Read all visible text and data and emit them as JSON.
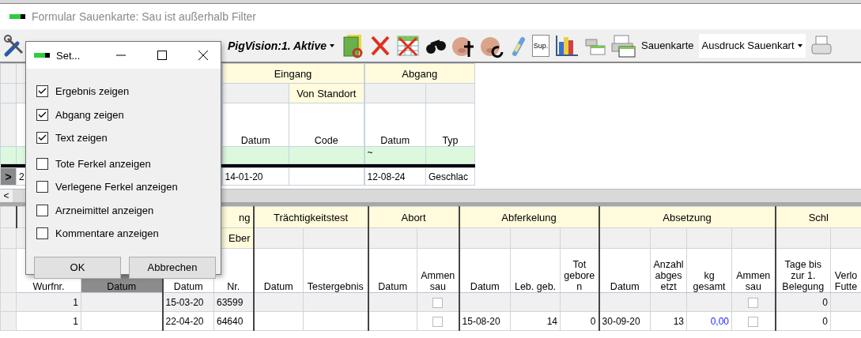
{
  "window": {
    "title": "Formular Sauenkarte: Sau ist außerhalb Filter"
  },
  "toolbar": {
    "view_combo": "PigVision:1. Aktive",
    "sup_label": "Sup.",
    "card_label": "Sauenkarte",
    "print_combo": "Ausdruck Sauenkart"
  },
  "upper_grid": {
    "groups": [
      {
        "label": "Eingang",
        "columns": [
          {
            "label": "Datum"
          },
          {
            "sub": "Von Standort",
            "label": "Code"
          }
        ]
      },
      {
        "label": "Abgang",
        "columns": [
          {
            "label": "Datum",
            "filter": "~"
          },
          {
            "label": "Typ"
          }
        ]
      }
    ],
    "rows": [
      {
        "indicator": ">",
        "selected": true,
        "lead": "2",
        "cells": [
          "14-01-20",
          "",
          "12-08-24",
          "Geschlac"
        ]
      }
    ],
    "scroll_left": "<"
  },
  "lower_grid": {
    "groups": [
      {
        "columns": [
          {
            "label": "Wurfnr.",
            "kind": "number",
            "selected": false
          },
          {
            "label": "Datum",
            "kind": "date",
            "selected": true
          }
        ]
      },
      {
        "label": "ng",
        "columns": [
          {
            "label": "Datum",
            "kind": "date",
            "selected": false
          },
          {
            "label": "Nr.",
            "sub": "Eber",
            "kind": "date",
            "selected": false
          }
        ]
      },
      {
        "label": "Trächtigkeitstest",
        "columns": [
          {
            "label": "Datum",
            "kind": "date",
            "selected": false
          },
          {
            "label": "Testergebnis",
            "kind": "text",
            "selected": false
          }
        ]
      },
      {
        "label": "Abort",
        "columns": [
          {
            "label": "Datum",
            "kind": "date",
            "selected": false
          },
          {
            "label": "Ammen sau",
            "kind": "check",
            "selected": false
          }
        ]
      },
      {
        "label": "Abferkelung",
        "columns": [
          {
            "label": "Datum",
            "kind": "date",
            "selected": false
          },
          {
            "label": "Leb. geb.",
            "kind": "number",
            "selected": false
          },
          {
            "label": "Tot geboren",
            "kind": "number",
            "selected": false
          }
        ]
      },
      {
        "label": "Absetzung",
        "columns": [
          {
            "label": "Datum",
            "kind": "date",
            "selected": false
          },
          {
            "label": "Anzahl abgesetzt",
            "kind": "number",
            "selected": false
          },
          {
            "label": "kg gesamt",
            "kind": "calc",
            "selected": false
          },
          {
            "label": "Ammen sau",
            "kind": "check",
            "selected": false
          }
        ]
      },
      {
        "label": "Schl",
        "columns": [
          {
            "label": "Tage bis zur 1. Belegung",
            "kind": "number",
            "selected": false
          },
          {
            "label": "Verlo Futte",
            "kind": "text",
            "selected": false
          }
        ]
      }
    ],
    "rows": [
      {
        "readonly": true,
        "cells": [
          "1",
          "",
          "15-03-20",
          "63599",
          "",
          "",
          "",
          {
            "checked": false
          },
          "",
          "",
          "",
          "",
          "",
          "",
          {
            "checked": false
          },
          "0",
          ""
        ]
      },
      {
        "readonly": false,
        "cells": [
          "1",
          "",
          "22-04-20",
          "64640",
          "",
          "",
          "",
          {
            "checked": false
          },
          "15-08-20",
          "14",
          "0",
          "30-09-20",
          "13",
          "0,00",
          {
            "checked": false
          },
          "0",
          ""
        ]
      }
    ]
  },
  "dialog": {
    "title": "Set...",
    "options": [
      {
        "label": "Ergebnis zeigen",
        "checked": true
      },
      {
        "label": "Abgang zeigen",
        "checked": true
      },
      {
        "label": "Text zeigen",
        "checked": true
      },
      {
        "label": "Tote Ferkel anzeigen",
        "checked": false
      },
      {
        "label": "Verlegene Ferkel anzeigen",
        "checked": false
      },
      {
        "label": "Arzneimittel anzeigen",
        "checked": false
      },
      {
        "label": "Kommentare anzeigen",
        "checked": false
      }
    ],
    "buttons": [
      "OK",
      "Abbrechen"
    ]
  }
}
